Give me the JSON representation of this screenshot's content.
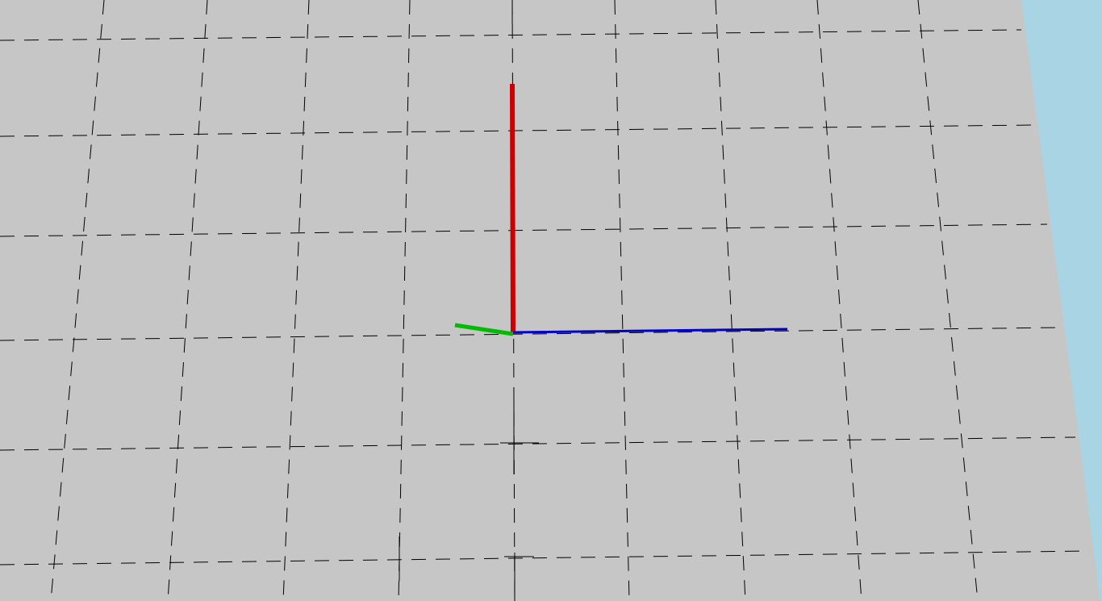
{
  "scene": {
    "colors": {
      "ground": "#c6c6c6",
      "sky": "#a9d4e4",
      "grid_line": "#000000",
      "axis_x": "#cc0000",
      "axis_y": "#00bb00",
      "axis_z": "#0000cc"
    },
    "elements": {
      "ground_plane": "ground-plane",
      "sky_region": "sky-background",
      "grid": "ground-grid",
      "axes_gizmo": "coordinate-axes-gizmo"
    }
  }
}
